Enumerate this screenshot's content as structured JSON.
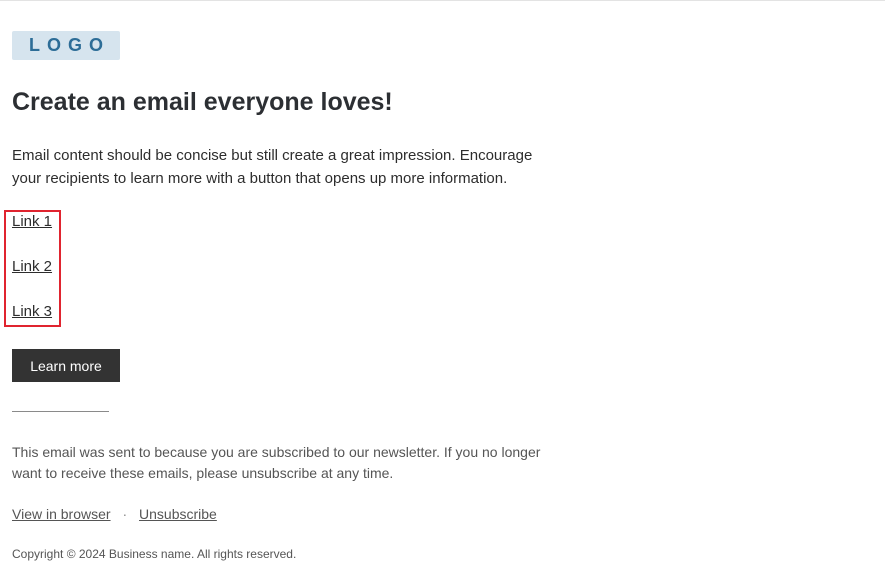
{
  "logo": {
    "text": "LOGO"
  },
  "headline": "Create an email everyone loves!",
  "body_text": "Email content should be concise but still create a great impression. Encourage your recipients to learn more with a button that opens up more information.",
  "links": [
    {
      "label": "Link 1"
    },
    {
      "label": "Link 2"
    },
    {
      "label": "Link 3"
    }
  ],
  "highlight_color": "#e0242f",
  "cta": {
    "label": "Learn more"
  },
  "footer": {
    "notice": "This email was sent to  because you are subscribed to our newsletter. If you no longer want to receive these emails, please unsubscribe at any time.",
    "view_in_browser": "View in browser",
    "separator": "·",
    "unsubscribe": "Unsubscribe",
    "copyright": "Copyright © 2024 Business name. All rights reserved."
  }
}
